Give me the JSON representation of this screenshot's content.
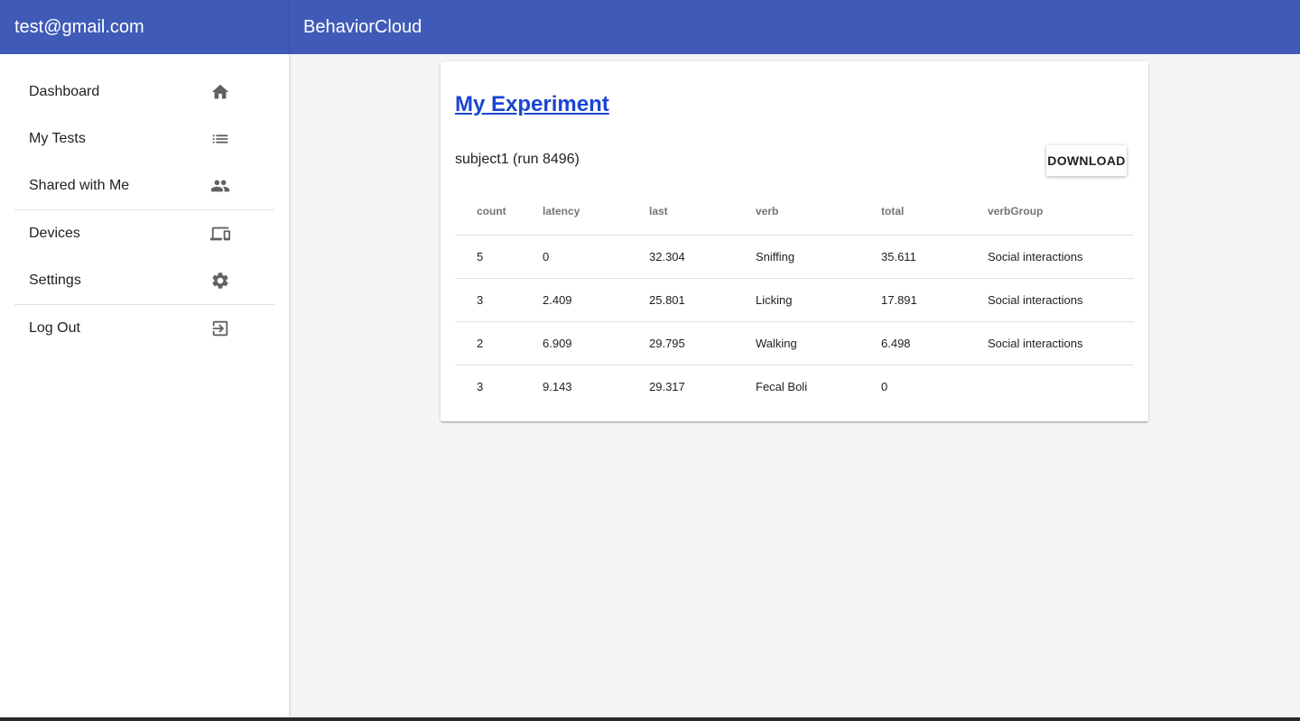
{
  "header": {
    "user_email": "test@gmail.com",
    "app_title": "BehaviorCloud"
  },
  "sidebar": {
    "items": [
      {
        "label": "Dashboard",
        "icon": "home-icon"
      },
      {
        "label": "My Tests",
        "icon": "list-icon"
      },
      {
        "label": "Shared with Me",
        "icon": "people-icon"
      },
      {
        "label": "Devices",
        "icon": "devices-icon"
      },
      {
        "label": "Settings",
        "icon": "gear-icon"
      },
      {
        "label": "Log Out",
        "icon": "logout-icon"
      }
    ]
  },
  "experiment": {
    "title": "My Experiment",
    "subject": "subject1 (run 8496)",
    "download_label": "DOWNLOAD"
  },
  "table": {
    "columns": [
      "count",
      "latency",
      "last",
      "verb",
      "total",
      "verbGroup"
    ],
    "rows": [
      [
        "5",
        "0",
        "32.304",
        "Sniffing",
        "35.611",
        "Social interactions"
      ],
      [
        "3",
        "2.409",
        "25.801",
        "Licking",
        "17.891",
        "Social interactions"
      ],
      [
        "2",
        "6.909",
        "29.795",
        "Walking",
        "6.498",
        "Social interactions"
      ],
      [
        "3",
        "9.143",
        "29.317",
        "Fecal Boli",
        "0",
        ""
      ]
    ]
  },
  "colors": {
    "header_bg": "#3f5bb7",
    "link": "#1a45d1",
    "page_bg": "#f5f5f5"
  }
}
